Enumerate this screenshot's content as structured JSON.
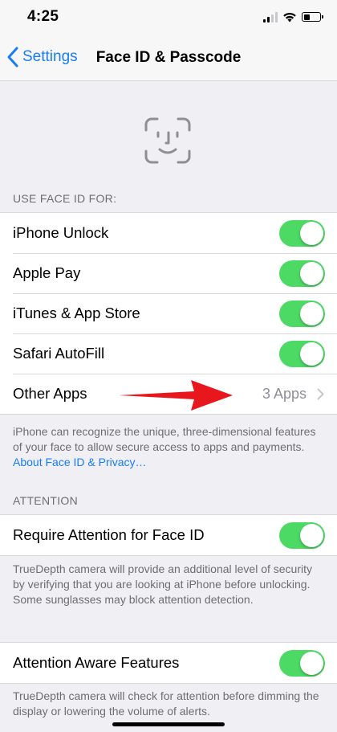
{
  "status_bar": {
    "time": "4:25",
    "battery_level_percent": 40,
    "signal_bars_on": 2,
    "signal_bars_total": 4
  },
  "nav": {
    "back_label": "Settings",
    "title": "Face ID & Passcode"
  },
  "colors": {
    "accent": "#1a7cf6",
    "toggle_on": "#4cd964",
    "annotation_arrow": "#e8171d"
  },
  "use_face_id": {
    "header": "USE FACE ID FOR:",
    "rows": [
      {
        "label": "iPhone Unlock",
        "toggle_on": true
      },
      {
        "label": "Apple Pay",
        "toggle_on": true
      },
      {
        "label": "iTunes & App Store",
        "toggle_on": true
      },
      {
        "label": "Safari AutoFill",
        "toggle_on": true
      }
    ],
    "other_apps": {
      "label": "Other Apps",
      "value": "3 Apps"
    },
    "footnote_text": "iPhone can recognize the unique, three-dimensional features of your face to allow secure access to apps and payments. ",
    "footnote_link": "About Face ID & Privacy…"
  },
  "attention": {
    "header": "ATTENTION",
    "require_label": "Require Attention for Face ID",
    "require_on": true,
    "require_footnote": "TrueDepth camera will provide an additional level of security by verifying that you are looking at iPhone before unlocking. Some sunglasses may block attention detection.",
    "aware_label": "Attention Aware Features",
    "aware_on": true,
    "aware_footnote": "TrueDepth camera will check for attention before dimming the display or lowering the volume of alerts."
  }
}
